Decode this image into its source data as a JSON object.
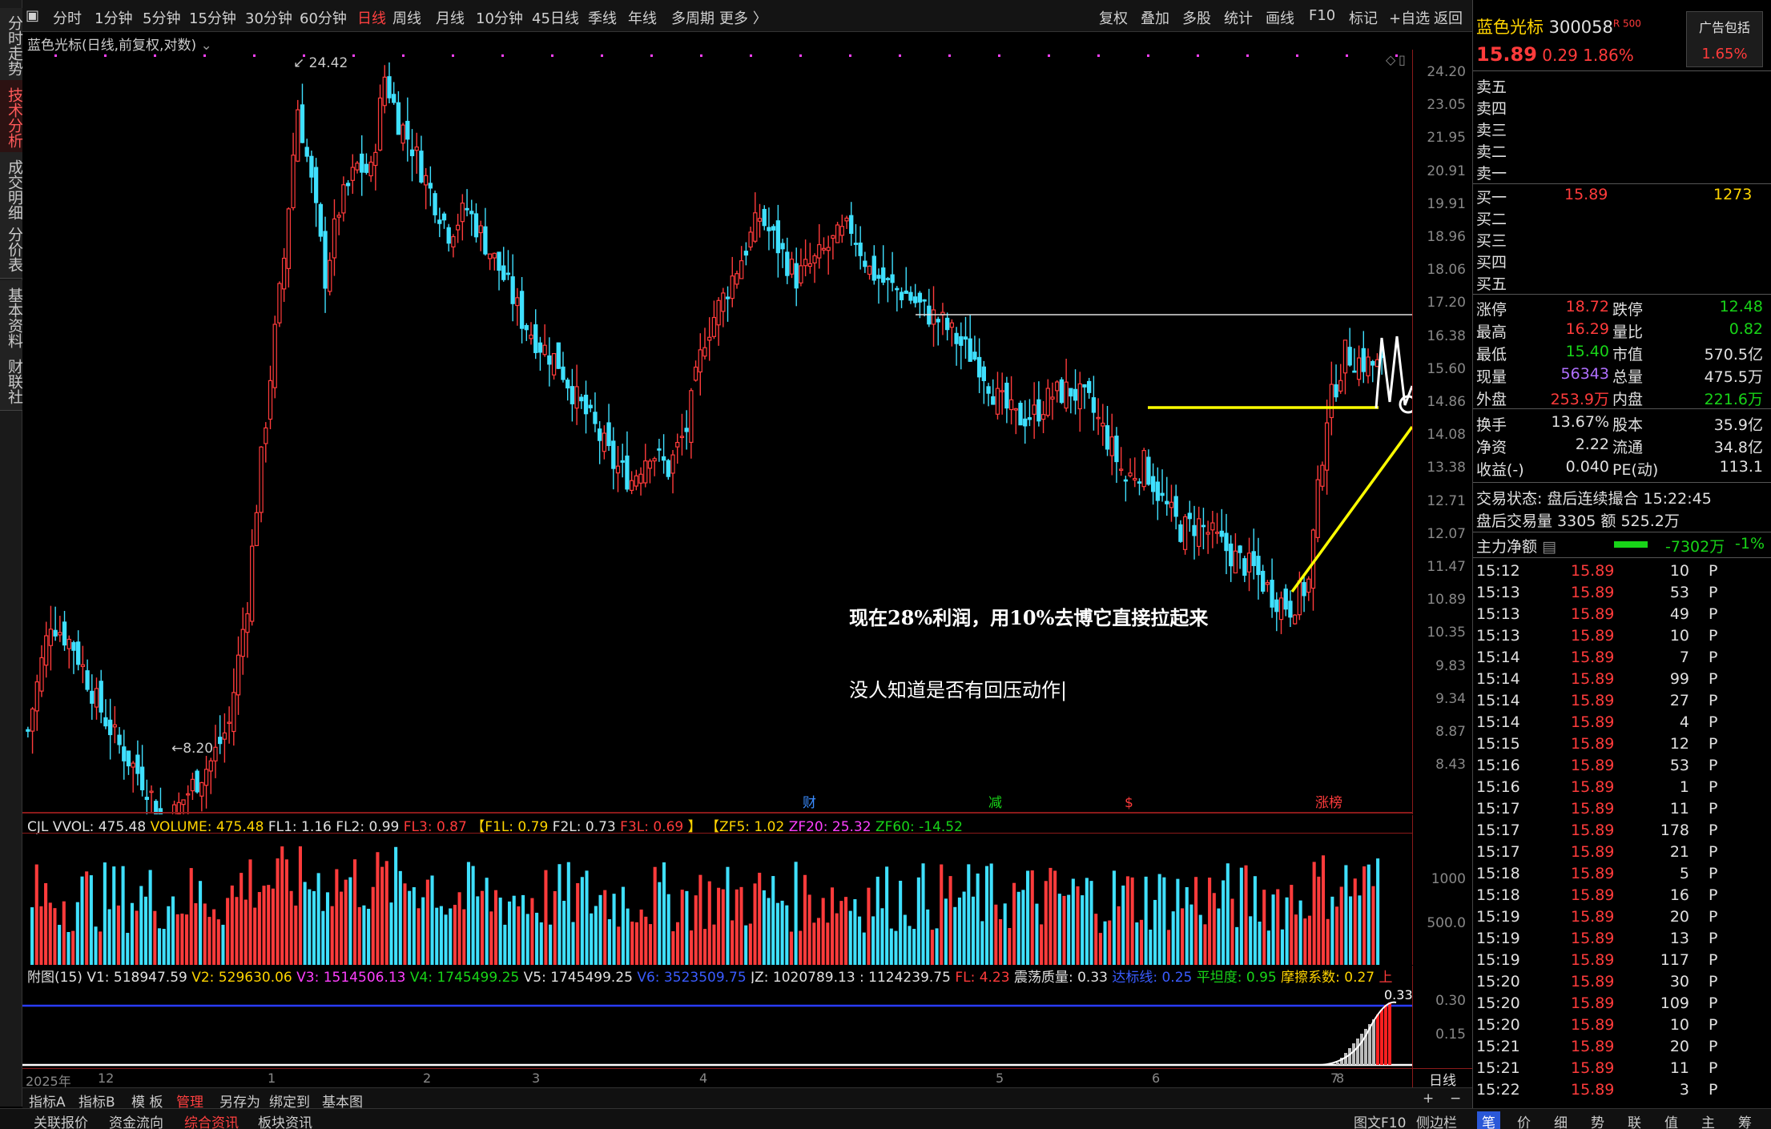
{
  "left_rail": {
    "tabs": [
      "分时走势",
      "技术分析",
      "成交明细",
      "分价表",
      "基本资料",
      "财联社"
    ]
  },
  "toolbar": {
    "left_items": [
      "分时",
      "1分钟",
      "5分钟",
      "15分钟",
      "30分钟",
      "60分钟",
      "日线",
      "周线",
      "月线",
      "10分钟",
      "45日线",
      "季线",
      "年线",
      "多周期",
      "更多 〉"
    ],
    "active_item": "日线",
    "right_items": [
      "复权",
      "叠加",
      "多股",
      "统计",
      "画线",
      "F10",
      "标记",
      "+自选",
      "返回"
    ]
  },
  "chart": {
    "title": "蓝色光标(日线,前复权,对数)",
    "high_label": "24.42",
    "low_label": "8.20",
    "annotation_line1": "现在28%利润，用10%去博它直接拉起来",
    "annotation_line2": "没人知道是否有回压动作",
    "event_markers": [
      "财",
      "减",
      "$",
      "涨榜"
    ],
    "price_ticks": [
      "24.20",
      "23.05",
      "21.95",
      "20.91",
      "19.91",
      "18.96",
      "18.06",
      "17.20",
      "16.38",
      "15.60",
      "14.86",
      "14.08",
      "13.38",
      "12.71",
      "12.07",
      "11.47",
      "10.89",
      "10.35",
      "9.83",
      "9.34",
      "8.87",
      "8.43"
    ]
  },
  "volume": {
    "label": "CJL",
    "vvol": "VVOL: 475.48",
    "volume": "VOLUME: 475.48",
    "fl1": "FL1: 1.16",
    "fl2": "FL2: 0.99",
    "fl3": "FL3: 0.87",
    "f1l": "【F1L: 0.79",
    "f2l": "F2L: 0.73",
    "f3l": "F3L: 0.69",
    "bracket_close": "】",
    "zf5": "【ZF5: 1.02",
    "zf20": "ZF20: 25.32",
    "zf60": "ZF60: -14.52",
    "axis_ticks": [
      "1000",
      "500.0"
    ]
  },
  "indicator": {
    "label": "附图(15)",
    "v1": "V1: 518947.59",
    "v2": "V2: 529630.06",
    "v3": "V3: 1514506.13",
    "v4": "V4: 1745499.25",
    "v5": "V5: 1745499.25",
    "v6": "V6: 3523509.75",
    "jz": "JZ: 1020789.13 : 1124239.75",
    "fl": "FL: 4.23",
    "zd": "震荡质量: 0.33",
    "dbx": "达标线: 0.25",
    "ptd": "平坦度: 0.95",
    "mcxs": "摩擦系数: 0.27",
    "more": "上",
    "axis_ticks": [
      "0.30",
      "0.15"
    ],
    "last_value": "0.33"
  },
  "date_axis": {
    "labels": [
      "2025年",
      "12",
      "1",
      "2",
      "3",
      "4",
      "5",
      "6",
      "7",
      "8"
    ],
    "period": "日线"
  },
  "bottom_tabs1": [
    "指标A",
    "指标B",
    "模 板",
    "管理",
    "另存为",
    "绑定到",
    "基本图"
  ],
  "bottom_tabs1_active": "管理",
  "bottom_tabs2": [
    "关联报价",
    "资金流向",
    "综合资讯",
    "板块资讯"
  ],
  "bottom_tabs2_active": "综合资讯",
  "bottom_right": [
    "图文F10",
    "侧边栏",
    "笔",
    "价",
    "细",
    "势",
    "联",
    "值",
    "主",
    "筹"
  ],
  "stock": {
    "name": "蓝色光标",
    "code": "300058",
    "badge": "R 500",
    "ad": "广告包括",
    "price": "15.89",
    "change": "0.29",
    "pct": "1.86%",
    "ad_pct": "1.65%"
  },
  "order_book": {
    "sells": [
      "卖五",
      "卖四",
      "卖三",
      "卖二",
      "卖一"
    ],
    "buys": [
      {
        "label": "买一",
        "price": "15.89",
        "vol": "1273"
      },
      {
        "label": "买二",
        "price": "",
        "vol": ""
      },
      {
        "label": "买三",
        "price": "",
        "vol": ""
      },
      {
        "label": "买四",
        "price": "",
        "vol": ""
      },
      {
        "label": "买五",
        "price": "",
        "vol": ""
      }
    ]
  },
  "quote": {
    "rows": [
      {
        "k1": "涨停",
        "v1": "18.72",
        "c1": "red",
        "k2": "跌停",
        "v2": "12.48",
        "c2": "green"
      },
      {
        "k1": "最高",
        "v1": "16.29",
        "c1": "red",
        "k2": "量比",
        "v2": "0.82",
        "c2": "green"
      },
      {
        "k1": "最低",
        "v1": "15.40",
        "c1": "green",
        "k2": "市值",
        "v2": "570.5亿",
        "c2": "white"
      },
      {
        "k1": "现量",
        "v1": "56343",
        "c1": "purple",
        "k2": "总量",
        "v2": "475.5万",
        "c2": "white"
      },
      {
        "k1": "外盘",
        "v1": "253.9万",
        "c1": "red",
        "k2": "内盘",
        "v2": "221.6万",
        "c2": "green"
      },
      {
        "k1": "换手",
        "v1": "13.67%",
        "c1": "white",
        "k2": "股本",
        "v2": "35.9亿",
        "c2": "white"
      },
      {
        "k1": "净资",
        "v1": "2.22",
        "c1": "white",
        "k2": "流通",
        "v2": "34.8亿",
        "c2": "white"
      },
      {
        "k1": "收益(-)",
        "v1": "0.040",
        "c1": "white",
        "k2": "PE(动)",
        "v2": "113.1",
        "c2": "white"
      }
    ],
    "trade_status": "交易状态: 盘后连续撮合 15:22:45",
    "after_hours": "盘后交易量 3305 额 525.2万",
    "main_flow_label": "主力净额",
    "main_flow_value": "-7302万",
    "main_flow_pct": "-1%"
  },
  "ticks": [
    {
      "t": "15:12",
      "p": "15.89",
      "v": "10",
      "f": "P"
    },
    {
      "t": "15:13",
      "p": "15.89",
      "v": "53",
      "f": "P"
    },
    {
      "t": "15:13",
      "p": "15.89",
      "v": "49",
      "f": "P"
    },
    {
      "t": "15:13",
      "p": "15.89",
      "v": "10",
      "f": "P"
    },
    {
      "t": "15:14",
      "p": "15.89",
      "v": "7",
      "f": "P"
    },
    {
      "t": "15:14",
      "p": "15.89",
      "v": "99",
      "f": "P"
    },
    {
      "t": "15:14",
      "p": "15.89",
      "v": "27",
      "f": "P"
    },
    {
      "t": "15:14",
      "p": "15.89",
      "v": "4",
      "f": "P"
    },
    {
      "t": "15:15",
      "p": "15.89",
      "v": "12",
      "f": "P"
    },
    {
      "t": "15:16",
      "p": "15.89",
      "v": "53",
      "f": "P"
    },
    {
      "t": "15:16",
      "p": "15.89",
      "v": "1",
      "f": "P"
    },
    {
      "t": "15:17",
      "p": "15.89",
      "v": "11",
      "f": "P"
    },
    {
      "t": "15:17",
      "p": "15.89",
      "v": "178",
      "f": "P"
    },
    {
      "t": "15:17",
      "p": "15.89",
      "v": "21",
      "f": "P"
    },
    {
      "t": "15:18",
      "p": "15.89",
      "v": "5",
      "f": "P"
    },
    {
      "t": "15:18",
      "p": "15.89",
      "v": "16",
      "f": "P"
    },
    {
      "t": "15:19",
      "p": "15.89",
      "v": "20",
      "f": "P"
    },
    {
      "t": "15:19",
      "p": "15.89",
      "v": "13",
      "f": "P"
    },
    {
      "t": "15:19",
      "p": "15.89",
      "v": "117",
      "f": "P"
    },
    {
      "t": "15:20",
      "p": "15.89",
      "v": "30",
      "f": "P"
    },
    {
      "t": "15:20",
      "p": "15.89",
      "v": "109",
      "f": "P"
    },
    {
      "t": "15:20",
      "p": "15.89",
      "v": "10",
      "f": "P"
    },
    {
      "t": "15:21",
      "p": "15.89",
      "v": "20",
      "f": "P"
    },
    {
      "t": "15:21",
      "p": "15.89",
      "v": "11",
      "f": "P"
    },
    {
      "t": "15:22",
      "p": "15.89",
      "v": "3",
      "f": "P"
    }
  ],
  "colors": {
    "up": "#ff3b3b",
    "down": "#3fe0ff",
    "annotation": "#ffff00",
    "grid_red": "#8b1a1a"
  }
}
